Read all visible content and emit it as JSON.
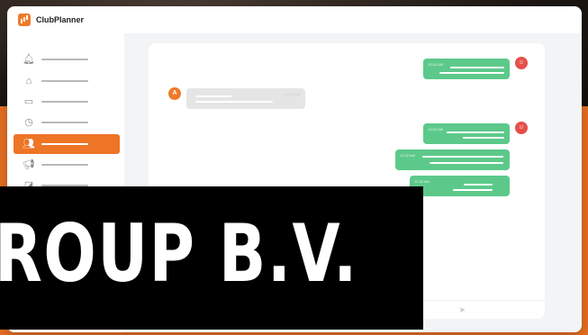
{
  "app": {
    "brand": "ClubPlanner",
    "logo_icon": "bar-chart-logo-icon"
  },
  "sidebar": {
    "items": [
      {
        "icon": "bell-icon",
        "glyph": "🔔︎",
        "active": false
      },
      {
        "icon": "home-icon",
        "glyph": "⌂",
        "active": false
      },
      {
        "icon": "calendar-icon",
        "glyph": "▭",
        "active": false
      },
      {
        "icon": "clock-icon",
        "glyph": "◷",
        "active": false
      },
      {
        "icon": "users-icon",
        "glyph": "👥︎",
        "active": true
      },
      {
        "icon": "megaphone-icon",
        "glyph": "📢︎",
        "active": false
      },
      {
        "icon": "chart-icon",
        "glyph": "◪",
        "active": false
      }
    ]
  },
  "chat": {
    "messages": [
      {
        "direction": "out",
        "time": "12:32 AM",
        "avatar": ""
      },
      {
        "direction": "in",
        "time": "12:32 AM",
        "avatar": "A"
      },
      {
        "direction": "out",
        "time": "12:32 AM",
        "avatar": ""
      },
      {
        "direction": "out",
        "time": "12:32 AM",
        "avatar": ""
      },
      {
        "direction": "out",
        "time": "12:32 AM",
        "avatar": ""
      }
    ],
    "send_icon": "send-icon",
    "send_glyph": "➤"
  },
  "overlay": {
    "text": "ROUP B.V."
  },
  "colors": {
    "accent": "#ee7426",
    "outgoing": "#5cc98a",
    "incoming": "#e5e5e5",
    "avatar_red": "#e5504a"
  }
}
